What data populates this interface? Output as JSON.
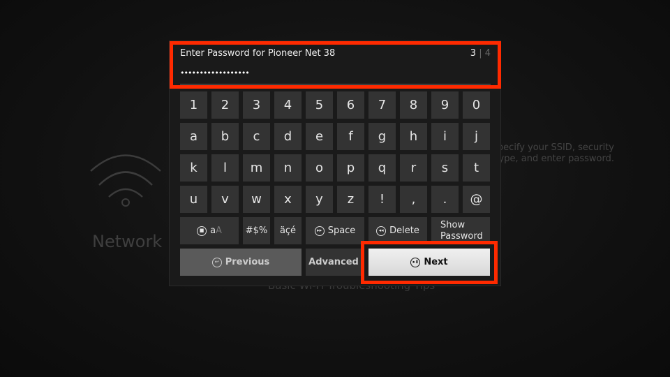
{
  "background": {
    "section_label": "Network",
    "description_line1": "Specify your SSID, security",
    "description_line2": "type, and enter password.",
    "tips_link": "Basic Wi-Fi Troubleshooting Tips"
  },
  "header": {
    "title": "Enter Password for Pioneer Net 38",
    "step_current": "3",
    "step_separator": "|",
    "step_total": "4",
    "password_value": "••••••••••••••••••"
  },
  "keys": {
    "row1": [
      "1",
      "2",
      "3",
      "4",
      "5",
      "6",
      "7",
      "8",
      "9",
      "0"
    ],
    "row2": [
      "a",
      "b",
      "c",
      "d",
      "e",
      "f",
      "g",
      "h",
      "i",
      "j"
    ],
    "row3": [
      "k",
      "l",
      "m",
      "n",
      "o",
      "p",
      "q",
      "r",
      "s",
      "t"
    ],
    "row4": [
      "u",
      "v",
      "w",
      "x",
      "y",
      "z",
      "!",
      ",",
      ".",
      "@"
    ]
  },
  "actions": {
    "case_a": "a",
    "case_A": "A",
    "symbols": "#$%",
    "accents": "äçé",
    "space": "Space",
    "delete": "Delete",
    "show_password_1": "Show",
    "show_password_2": "Password",
    "previous": "Previous",
    "advanced": "Advanced",
    "next": "Next"
  },
  "colors": {
    "highlight": "#ff2a00"
  }
}
